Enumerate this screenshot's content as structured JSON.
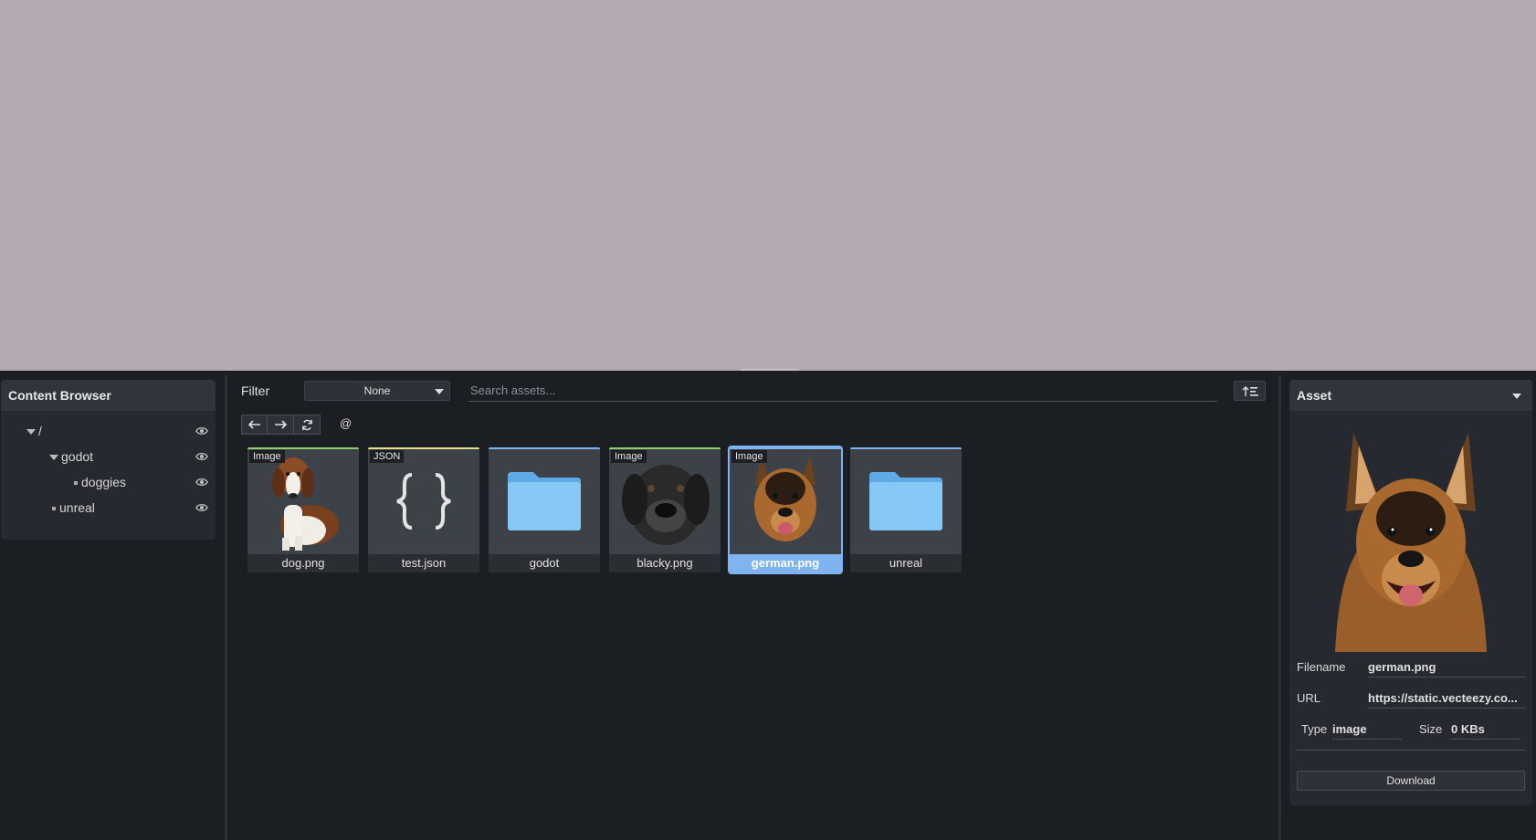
{
  "content_browser": {
    "title": "Content Browser",
    "tree": [
      {
        "label": "/",
        "kind": "expanded"
      },
      {
        "label": "godot",
        "kind": "expanded"
      },
      {
        "label": "doggies",
        "kind": "leaf"
      },
      {
        "label": "unreal",
        "kind": "leaf"
      }
    ]
  },
  "toolbar": {
    "filter_label": "Filter",
    "filter_value": "None",
    "search_placeholder": "Search assets...",
    "back_icon": "arrow-left-icon",
    "forward_icon": "arrow-right-icon",
    "refresh_icon": "refresh-icon",
    "at_label": "@",
    "sort_icon": "sort-icon"
  },
  "assets": [
    {
      "name": "dog.png",
      "tag": "Image",
      "type": "image",
      "accent": "#8fd06c"
    },
    {
      "name": "test.json",
      "tag": "JSON",
      "type": "json",
      "accent": "#e6e08a"
    },
    {
      "name": "godot",
      "tag": "",
      "type": "folder",
      "accent": "#7fb4f0"
    },
    {
      "name": "blacky.png",
      "tag": "Image",
      "type": "image",
      "accent": "#8fd06c"
    },
    {
      "name": "german.png",
      "tag": "Image",
      "type": "image",
      "accent": "#7fb4f0",
      "selected": true
    },
    {
      "name": "unreal",
      "tag": "",
      "type": "folder",
      "accent": "#7fb4f0"
    }
  ],
  "asset_panel": {
    "title": "Asset",
    "filename_label": "Filename",
    "filename": "german.png",
    "url_label": "URL",
    "url": "https://static.vecteezy.co...",
    "type_label": "Type",
    "type": "image",
    "size_label": "Size",
    "size": "0 KBs",
    "download_label": "Download"
  },
  "colors": {
    "viewport": "#b5a9b2",
    "panel": "#1b1e23",
    "selection": "#7fb4f0",
    "folder": "#86c8f5"
  }
}
